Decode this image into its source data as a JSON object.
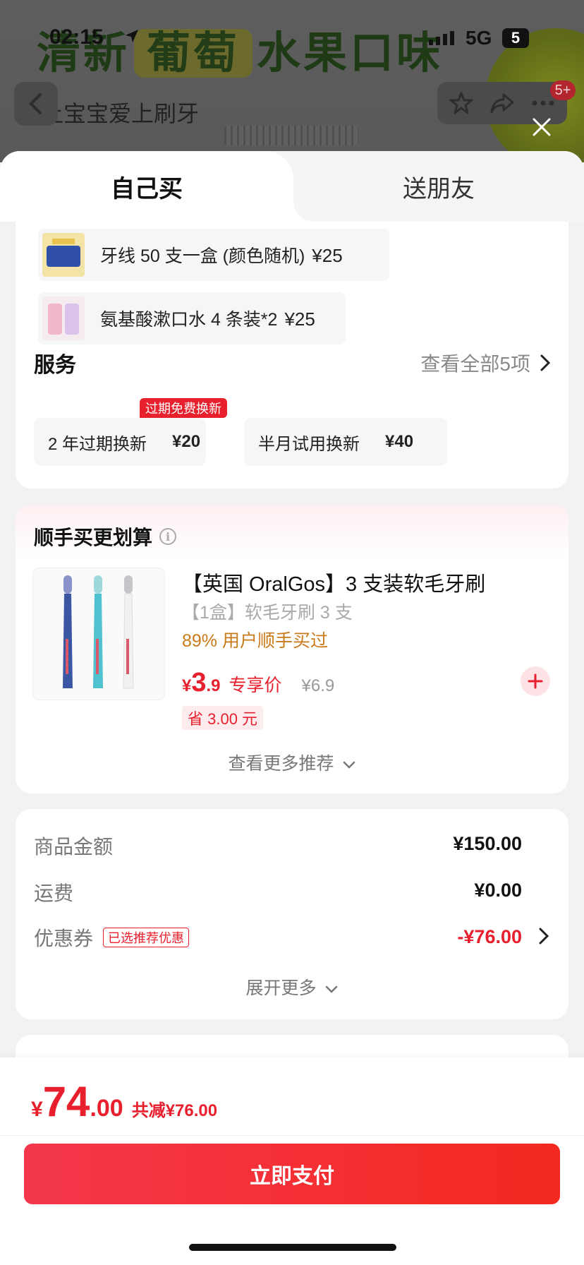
{
  "status_bar": {
    "time": "02:15",
    "network": "5G",
    "battery": "5"
  },
  "background": {
    "headline_pre": "清新",
    "headline_hl": "葡萄",
    "headline_post": "水果口味",
    "subtitle": "让宝宝爱上刷牙",
    "cart_badge": "5+"
  },
  "tabs": {
    "buy_self": "自己买",
    "gift_friend": "送朋友"
  },
  "addons": [
    {
      "name": "牙线 50 支一盒 (颜色随机)",
      "price": "¥25"
    },
    {
      "name": "氨基酸漱口水 4 条装*2",
      "price": "¥25"
    }
  ],
  "service": {
    "title": "服务",
    "see_all": "查看全部5项",
    "tag": "过期免费换新",
    "options": [
      {
        "name": "2 年过期换新",
        "price": "¥20"
      },
      {
        "name": "半月试用换新",
        "price": "¥40"
      }
    ]
  },
  "upsell": {
    "title": "顺手买更划算",
    "product_name": "【英国 OralGos】3 支装软毛牙刷",
    "spec": "【1盒】软毛牙刷 3 支",
    "buyers": "89% 用户顺手买过",
    "price_currency": "¥",
    "price_int": "3",
    "price_dec": ".9",
    "price_label": "专享价",
    "original_price": "¥6.9",
    "savings": "省 3.00 元",
    "more": "查看更多推荐"
  },
  "totals": {
    "goods_label": "商品金额",
    "goods_value": "¥150.00",
    "shipping_label": "运费",
    "shipping_value": "¥0.00",
    "coupon_label": "优惠券",
    "coupon_tag": "已选推荐优惠",
    "coupon_value": "-¥76.00",
    "expand": "展开更多"
  },
  "bottom": {
    "currency": "¥",
    "total_int": "74",
    "total_dec": ".00",
    "discount": "共减¥76.00",
    "pay_label": "立即支付"
  },
  "colors": {
    "accent_red": "#e8202e",
    "orange": "#c97a1a",
    "pay_gradient_start": "#f4374c",
    "pay_gradient_end": "#f3291f"
  }
}
